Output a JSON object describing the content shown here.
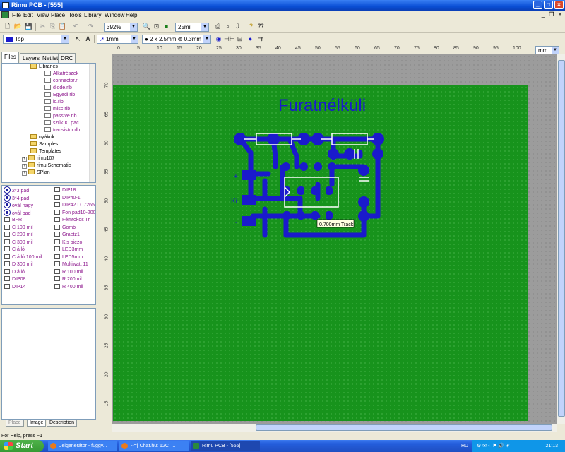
{
  "window": {
    "title": "Rimu PCB - [555]"
  },
  "menu": [
    "File",
    "Edit",
    "View",
    "Place",
    "Tools",
    "Library",
    "Window",
    "Help"
  ],
  "toolbar1": {
    "zoom": "392%",
    "grid": "25mil"
  },
  "toolbar2": {
    "layer": "Top",
    "track_width": "1mm",
    "pad_size": "2 x 2.5mm",
    "hole_size": "0.3mm"
  },
  "left_tabs": [
    "Files",
    "Layers",
    "Netlist",
    "DRC"
  ],
  "tree": [
    {
      "label": "Libraries",
      "type": "folder",
      "level": 2,
      "color": "#000"
    },
    {
      "label": "Alkatrészek",
      "type": "file",
      "level": 3,
      "color": "#8e1a8e"
    },
    {
      "label": "connector.r",
      "type": "file",
      "level": 3,
      "color": "#8e1a8e"
    },
    {
      "label": "diode.rlb",
      "type": "file",
      "level": 3,
      "color": "#8e1a8e"
    },
    {
      "label": "Egyedi.rlb",
      "type": "file",
      "level": 3,
      "color": "#8e1a8e"
    },
    {
      "label": "ic.rlb",
      "type": "file",
      "level": 3,
      "color": "#8e1a8e"
    },
    {
      "label": "misc.rlb",
      "type": "file",
      "level": 3,
      "color": "#8e1a8e"
    },
    {
      "label": "passive.rlb",
      "type": "file",
      "level": 3,
      "color": "#8e1a8e"
    },
    {
      "label": "szűk IC pac",
      "type": "file",
      "level": 3,
      "color": "#8e1a8e"
    },
    {
      "label": "transistor.rlb",
      "type": "file",
      "level": 3,
      "color": "#8e1a8e"
    },
    {
      "label": "nyákok",
      "type": "folder",
      "level": 2,
      "color": "#000"
    },
    {
      "label": "Samples",
      "type": "folder",
      "level": 2,
      "color": "#000"
    },
    {
      "label": "Templates",
      "type": "folder",
      "level": 2,
      "color": "#000"
    },
    {
      "label": "rimu107",
      "type": "folder",
      "level": 1,
      "color": "#000"
    },
    {
      "label": "rimu Schematic",
      "type": "folder",
      "level": 1,
      "color": "#000"
    },
    {
      "label": "SPlan",
      "type": "folder",
      "level": 1,
      "color": "#000"
    }
  ],
  "parts_col1": [
    {
      "label": "2*3 pad",
      "round": true,
      "color": "#8e1a8e"
    },
    {
      "label": "3*4 pad",
      "round": true,
      "color": "#8e1a8e"
    },
    {
      "label": "ovál nagy",
      "round": true,
      "color": "#8e1a8e"
    },
    {
      "label": "ovál pad",
      "round": true,
      "color": "#8e1a8e"
    },
    {
      "label": "BFR",
      "round": false,
      "color": "#8e1a8e"
    },
    {
      "label": "C 100 mil",
      "round": false,
      "color": "#8e1a8e"
    },
    {
      "label": "C 200 mil",
      "round": false,
      "color": "#8e1a8e"
    },
    {
      "label": "C 300 mil",
      "round": false,
      "color": "#8e1a8e"
    },
    {
      "label": "C álló",
      "round": false,
      "color": "#8e1a8e"
    },
    {
      "label": "C álló 100 mil",
      "round": false,
      "color": "#8e1a8e"
    },
    {
      "label": "D 300 mil",
      "round": false,
      "color": "#8e1a8e"
    },
    {
      "label": "D álló",
      "round": false,
      "color": "#8e1a8e"
    },
    {
      "label": "DIP08",
      "round": false,
      "color": "#8e1a8e"
    },
    {
      "label": "DIP14",
      "round": false,
      "color": "#8e1a8e"
    }
  ],
  "parts_col2": [
    {
      "label": "DIP18"
    },
    {
      "label": "DIP40-1"
    },
    {
      "label": "DIP42 LC7265"
    },
    {
      "label": "Fon pad10-200n"
    },
    {
      "label": "Fémtokos Tr"
    },
    {
      "label": "Gomb"
    },
    {
      "label": "Graetz1"
    },
    {
      "label": "Kis piezo"
    },
    {
      "label": "LED3mm"
    },
    {
      "label": "LED5mm"
    },
    {
      "label": "Multiwatt 11"
    },
    {
      "label": "R 100 mil"
    },
    {
      "label": "R 200mil"
    },
    {
      "label": "R 400 mil"
    }
  ],
  "bottom_tabs": [
    "Place",
    "Image",
    "Description"
  ],
  "ruler_top": [
    "0",
    "5",
    "10",
    "15",
    "20",
    "25",
    "30",
    "35",
    "40",
    "45",
    "50",
    "55",
    "60",
    "65",
    "70",
    "75",
    "80",
    "85",
    "90",
    "95",
    "100"
  ],
  "ruler_left": [
    "70",
    "65",
    "60",
    "55",
    "50",
    "45",
    "40",
    "35",
    "30",
    "25",
    "20",
    "15"
  ],
  "ruler_unit": "mm",
  "board": {
    "title": "Furatnélküli",
    "tooltip": "0.700mm Track",
    "labels": {
      "plus": "+",
      "ki": "Ki",
      "minus": "-"
    },
    "track_color": "#1a1acc",
    "board_color": "#17931c"
  },
  "status": "For Help, press F1",
  "taskbar": {
    "start": "Start",
    "tasks": [
      "Jelgenerátor - függv...",
      "--=[ Chat.hu: 12C_...",
      "Rimu PCB - [555]"
    ],
    "lang": "HU",
    "clock": "21:13"
  }
}
